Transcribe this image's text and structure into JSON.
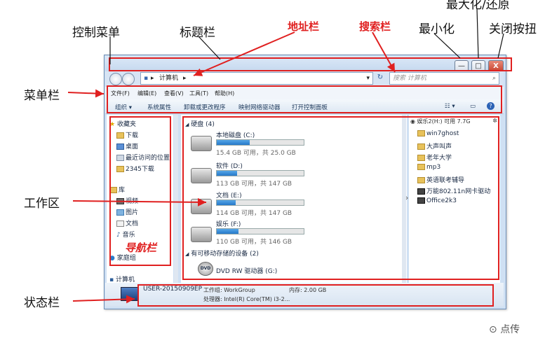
{
  "annotations": {
    "control_menu": "控制菜单",
    "title_bar": "标题栏",
    "address_bar": "地址栏",
    "search_bar": "搜索栏",
    "minimize": "最小化",
    "maximize_restore": "最大化/还原",
    "close_button": "关闭按扭",
    "menu_bar": "菜单栏",
    "work_area": "工作区",
    "nav_pane": "导航栏",
    "status_bar": "状态栏"
  },
  "window": {
    "address_path": "计算机",
    "search_placeholder": "搜索 计算机",
    "minimize_glyph": "—",
    "maximize_glyph": "□",
    "close_glyph": "X"
  },
  "menu": [
    "文件(F)",
    "编辑(E)",
    "查看(V)",
    "工具(T)",
    "帮助(H)"
  ],
  "toolbar": [
    "组织 ▾",
    "系统属性",
    "卸载或更改程序",
    "映射网络驱动器",
    "打开控制面板"
  ],
  "nav": {
    "favorites": "收藏夹",
    "fav_items": [
      "下载",
      "桌面",
      "最近访问的位置",
      "2345下载"
    ],
    "libraries": "库",
    "lib_items": [
      "视频",
      "图片",
      "文档",
      "音乐"
    ],
    "homegroup": "家庭组",
    "computer": "计算机"
  },
  "content": {
    "hdd_group": "硬盘 (4)",
    "drives": [
      {
        "name": "本地磁盘 (C:)",
        "info": "15.4 GB 可用，共 25.0 GB",
        "used": 0.38
      },
      {
        "name": "软件 (D:)",
        "info": "113 GB 可用，共 147 GB",
        "used": 0.23
      },
      {
        "name": "文档 (E:)",
        "info": "114 GB 可用，共 147 GB",
        "used": 0.22
      },
      {
        "name": "娱乐 (F:)",
        "info": "110 GB 可用，共 146 GB",
        "used": 0.25
      }
    ],
    "removable_group": "有可移动存储的设备 (2)",
    "dvd": "DVD RW 驱动器 (G:)"
  },
  "preview": {
    "header": "娱乐2(H:) 可用 7.7G",
    "items": [
      "win7ghost",
      "大声叫声",
      "老年大学",
      "mp3",
      "英语联考辅导",
      "万能802.11n网卡驱动",
      "Office2k3"
    ]
  },
  "status": {
    "computer_name": "USER-20150909EP",
    "workgroup": "工作组: WorkGroup",
    "memory": "内存: 2.00 GB",
    "processor": "处理器: Intel(R) Core(TM) i3-2..."
  },
  "watermark": "点传",
  "colors": {
    "annotation_red": "#e02020",
    "window_frame": "#cfe0f3",
    "bar_fill": "#2678c9"
  }
}
